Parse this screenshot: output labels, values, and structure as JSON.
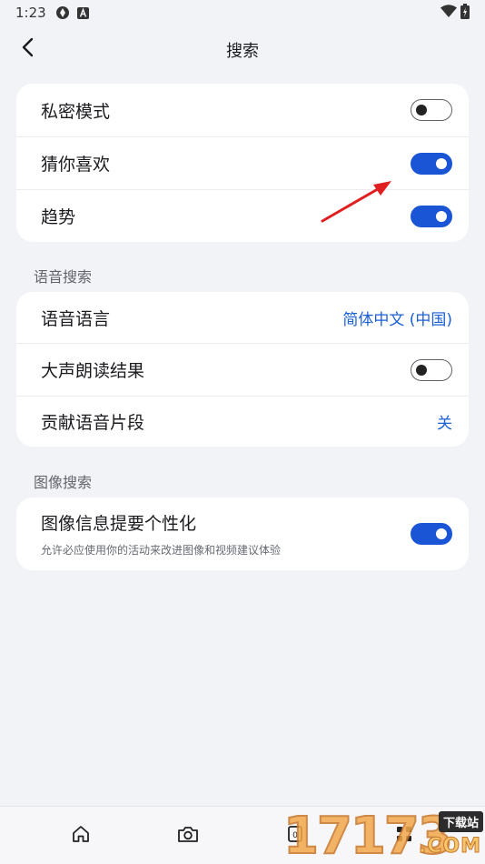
{
  "status_bar": {
    "time": "1:23",
    "icons_left": [
      "sync-icon",
      "font-a-icon"
    ],
    "icons_right": [
      "wifi-icon",
      "battery-icon"
    ]
  },
  "app_bar": {
    "title": "搜索",
    "back_icon": "chevron-left-icon"
  },
  "search_settings": {
    "private_mode": {
      "label": "私密模式",
      "enabled": false
    },
    "guess_you_like": {
      "label": "猜你喜欢",
      "enabled": true
    },
    "trending": {
      "label": "趋势",
      "enabled": true
    }
  },
  "voice_search": {
    "section_title": "语音搜索",
    "voice_language": {
      "label": "语音语言",
      "value": "简体中文 (中国)"
    },
    "read_aloud": {
      "label": "大声朗读结果",
      "enabled": false
    },
    "contribute_clips": {
      "label": "贡献语音片段",
      "value": "关"
    }
  },
  "image_search": {
    "section_title": "图像搜索",
    "personalization": {
      "label": "图像信息提要个性化",
      "description": "允许必应使用你的活动来改进图像和视频建议体验",
      "enabled": true
    }
  },
  "bottom_nav": {
    "items": [
      "home-icon",
      "camera-icon",
      "tabs-icon",
      "apps-icon"
    ]
  },
  "watermark": {
    "digits": "17173",
    "badge": "下载站",
    "domain": ".COM"
  },
  "colors": {
    "accent": "#1a55d6",
    "link": "#1a5fd6",
    "background": "#f2f3f7",
    "card": "#ffffff",
    "annotation_arrow": "#e02020"
  }
}
